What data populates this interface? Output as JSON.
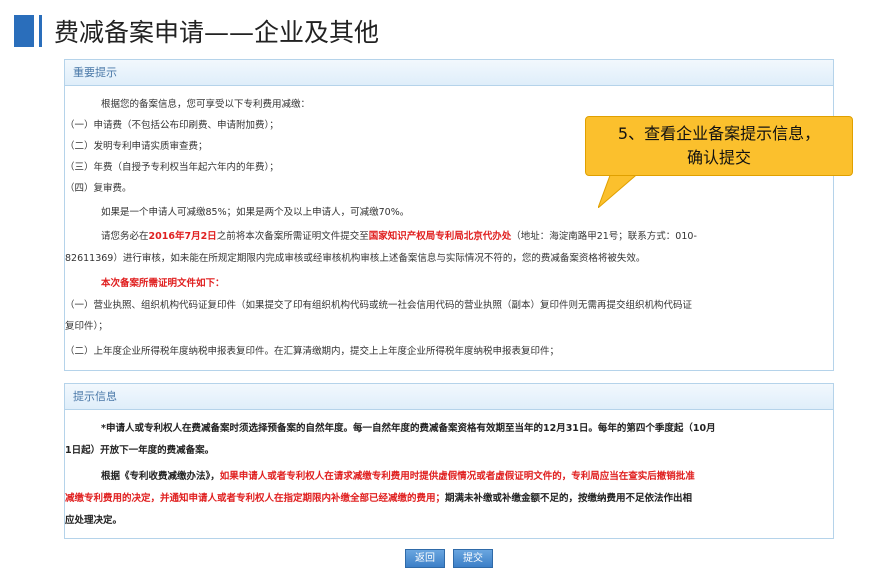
{
  "title": "费减备案申请——企业及其他",
  "notice_panel": {
    "header": "重要提示",
    "lines": [
      "根据您的备案信息，您可享受以下专利费用减缴：",
      "（一）申请费（不包括公布印刷费、申请附加费）；",
      "（二）发明专利申请实质审查费；",
      "（三）年费（自授予专利权当年起六年内的年费）；",
      "（四）复审费。",
      "如果是一个申请人可减缴85%；如果是两个及以上申请人，可减缴70%。"
    ],
    "deadline_prefix": "请您务必在",
    "deadline_date": "2016年7月2日",
    "deadline_mid": "之前将本次备案所需证明文件提交至",
    "deadline_office": "国家知识产权局专利局北京代办处",
    "deadline_suffix": "（地址：海淀南路甲21号；联系方式：010-",
    "deadline_line2": "82611369）进行审核，如未能在所规定期限内完成审核或经审核机构审核上述备案信息与实际情况不符的，您的费减备案资格将被失效。",
    "docs_title": "本次备案所需证明文件如下：",
    "doc1_a": "（一）营业执照、组织机构代码证复印件（如果提交了印有组织机构代码或统一社会信用代码的营业执照（副本）复印件则无需再提交组织机构代码证",
    "doc1_b": "复印件）；",
    "doc2": "（二）上年度企业所得税年度纳税申报表复印件。在汇算清缴期内，提交上上年度企业所得税年度纳税申报表复印件；"
  },
  "info_panel": {
    "header": "提示信息",
    "p1_a": "*申请人或专利权人在费减备案时须选择预备案的自然年度。每一自然年度的费减备案资格有效期至当年的12月31日。每年的第四个季度起（10月",
    "p1_b": "1日起）开放下一年度的费减备案。",
    "p2_a_black": "根据《专利收费减缴办法》，",
    "p2_a_red": "如果申请人或者专利权人在请求减缴专利费用时提供虚假情况或者虚假证明文件的，专利局应当在查实后撤销批准",
    "p2_b_red": "减缴专利费用的决定，并通知申请人或者专利权人在指定期限内补缴全部已经减缴的费用；",
    "p2_b_black": "期满未补缴或补缴金额不足的，按缴纳费用不足依法作出相",
    "p2_c": "应处理决定。"
  },
  "callout": {
    "line1": "5、查看企业备案提示信息，",
    "line2": "确认提交"
  },
  "buttons": {
    "back": "返回",
    "submit": "提交"
  }
}
